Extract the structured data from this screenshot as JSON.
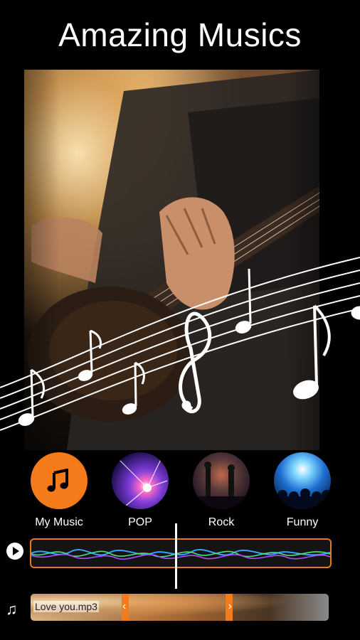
{
  "title": "Amazing Musics",
  "categories": [
    {
      "label": "My Music",
      "icon": "music-note-icon",
      "selected": true
    },
    {
      "label": "POP",
      "icon": "pop-thumbnail"
    },
    {
      "label": "Rock",
      "icon": "rock-thumbnail"
    },
    {
      "label": "Funny",
      "icon": "funny-thumbnail"
    }
  ],
  "track": {
    "file_name": "Love you.mp3",
    "left_handle": "‹",
    "right_handle": "›"
  },
  "colors": {
    "accent": "#f47a1a",
    "wave_blue": "#3aa0ff",
    "wave_green": "#4be07a",
    "wave_purple": "#b04cff",
    "background": "#000000"
  }
}
